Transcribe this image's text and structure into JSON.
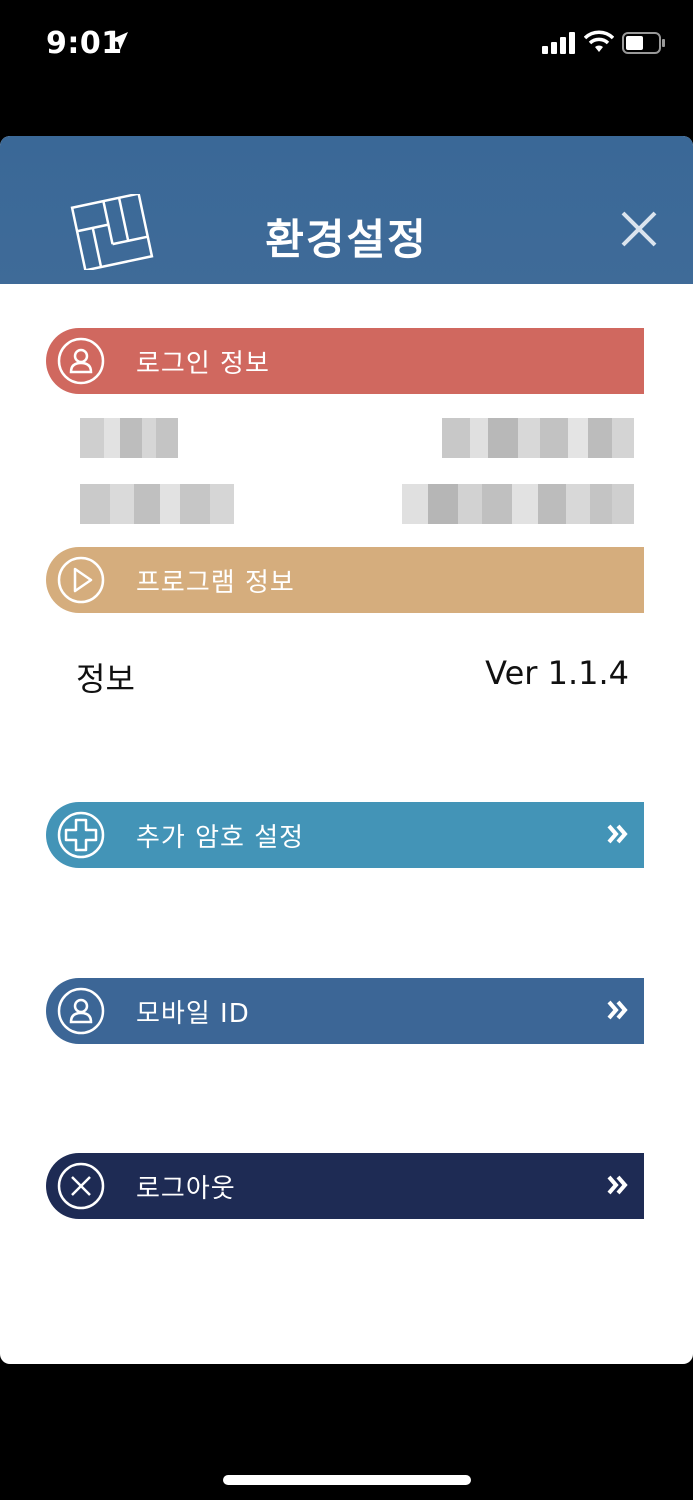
{
  "status_bar": {
    "time": "9:01"
  },
  "header": {
    "title": "환경설정"
  },
  "sections": {
    "login": {
      "label": "로그인 정보"
    },
    "program": {
      "label": "프로그램 정보"
    }
  },
  "program_info": {
    "label": "정보",
    "version": "Ver 1.1.4"
  },
  "menu": {
    "password": {
      "label": "추가 암호 설정"
    },
    "mobile_id": {
      "label": "모바일 ID"
    },
    "logout": {
      "label": "로그아웃"
    }
  },
  "colors": {
    "header": "#3f6b98",
    "login_bar": "#d0685f",
    "program_bar": "#d5ad7d",
    "password_bar": "#4394b7",
    "mobile_bar": "#3c6696",
    "logout_bar": "#1e2b54"
  }
}
